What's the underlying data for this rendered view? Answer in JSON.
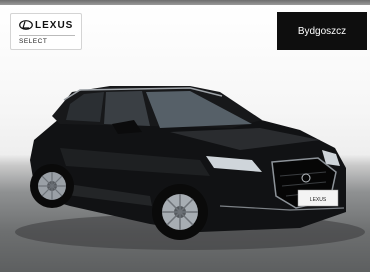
{
  "brand": {
    "name": "LEXUS",
    "program": "SELECT"
  },
  "location": {
    "city": "Bydgoszcz"
  },
  "listing": {
    "photo_subject": "Lexus NX SUV",
    "plate_text": "LEXUS"
  },
  "colors": {
    "badge_bg": "#0e0e0e",
    "car_body": "#111214"
  }
}
